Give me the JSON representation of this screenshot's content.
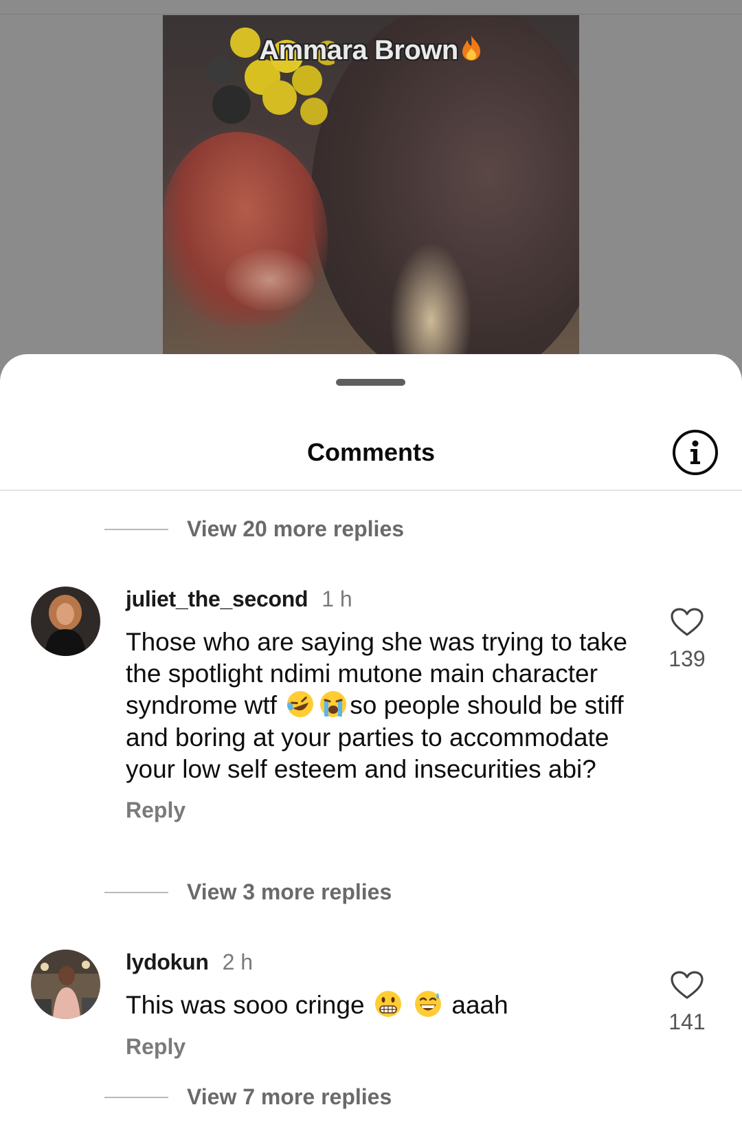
{
  "video": {
    "caption": "Ammara Brown",
    "caption_emoji": "fire-emoji"
  },
  "sheet": {
    "title": "Comments",
    "info_icon": "info-circle-icon"
  },
  "replies_toggles": [
    {
      "label": "View 20 more replies"
    },
    {
      "label": "View 3 more replies"
    },
    {
      "label": "View 7 more replies"
    }
  ],
  "comments": [
    {
      "username": "juliet_the_second",
      "time": "1 h",
      "text_part1": "Those who are saying she was trying to take the spotlight ndimi mutone main character syndrome wtf ",
      "emojis": [
        "rolling-on-floor-laughing-emoji",
        "loudly-crying-emoji"
      ],
      "text_part2": "so people should be stiff and boring at your parties to accommodate your low self esteem and insecurities abi?",
      "reply_label": "Reply",
      "likes": "139"
    },
    {
      "username": "lydokun",
      "time": "2 h",
      "text_part1": "This was sooo cringe ",
      "emojis": [
        "grimacing-face-emoji",
        "grinning-squinting-sweat-emoji"
      ],
      "text_part2": " aaah",
      "reply_label": "Reply",
      "likes": "141"
    }
  ],
  "colors": {
    "sheet_background": "#ffffff",
    "secondary_text": "#7a7a7a",
    "backdrop": "#8b8b8b"
  }
}
